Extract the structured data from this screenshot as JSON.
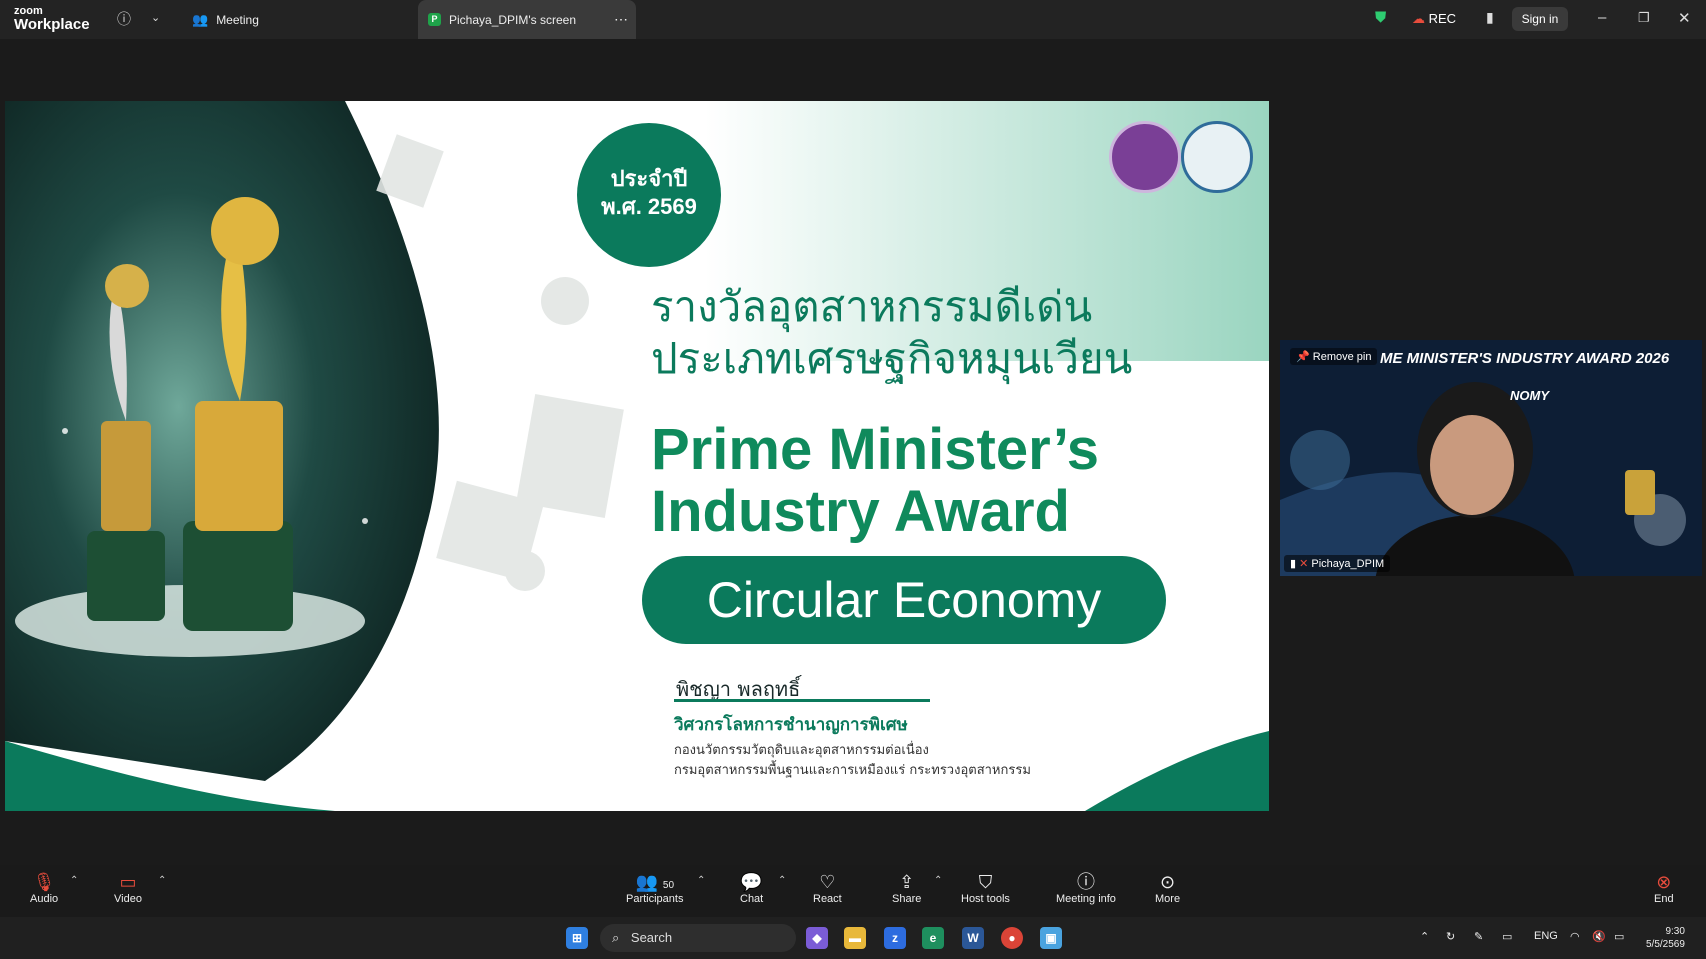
{
  "topbar": {
    "logo_small": "zoom",
    "logo_big": "Workplace",
    "meeting_tab": "Meeting",
    "share_tab": "Pichaya_DPIM's screen",
    "share_tab_badge": "P",
    "rec_label": "REC",
    "signin_label": "Sign in"
  },
  "slide": {
    "year_line1": "ประจำปี",
    "year_line2": "พ.ศ. 2569",
    "th_title_line1": "รางวัลอุตสาหกรรมดีเด่น",
    "th_title_line2": "ประเภทเศรษฐกิจหมุนเวียน",
    "en_title_line1": "Prime Minister’s",
    "en_title_line2": "Industry Award",
    "pill_text": "Circular Economy",
    "speaker_name": "พิชญา พลฤทธิ์",
    "speaker_role": "วิศวกรโลหการชำนาญการพิเศษ",
    "speaker_org1": "กองนวัตกรรมวัตถุดิบและอุตสาหกรรมต่อเนื่อง",
    "speaker_org2": "กรมอุตสาหกรรมพื้นฐานและการเหมืองแร่ กระทรวงอุตสาหกรรม",
    "colors": {
      "green": "#0b7a5c",
      "green_light": "#0f8a5c"
    }
  },
  "video": {
    "pin_label": "Remove pin",
    "banner": "ME MINISTER'S INDUSTRY AWARD 2026",
    "banner2": "NOMY",
    "participant_name": "Pichaya_DPIM"
  },
  "toolbar": {
    "audio": "Audio",
    "video": "Video",
    "participants": "Participants",
    "participants_count": "50",
    "chat": "Chat",
    "react": "React",
    "share": "Share",
    "host_tools": "Host tools",
    "meeting_info": "Meeting info",
    "more": "More",
    "end": "End"
  },
  "taskbar": {
    "search_label": "Search",
    "lang": "ENG",
    "time": "9:30",
    "date": "5/5/2569"
  }
}
